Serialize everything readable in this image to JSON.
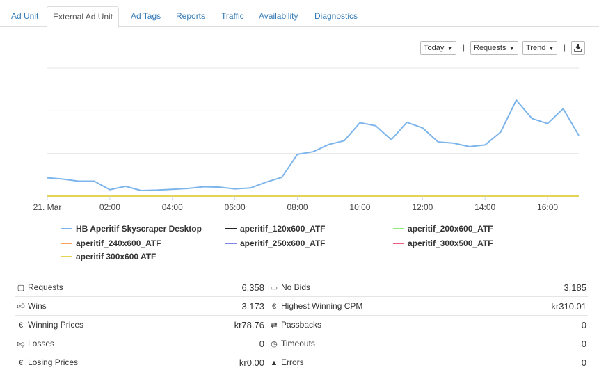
{
  "tabs": [
    {
      "label": "Ad Unit",
      "active": false
    },
    {
      "label": "External Ad Unit",
      "active": true
    },
    {
      "label": "Ad Tags",
      "active": false
    },
    {
      "label": "Reports",
      "active": false
    },
    {
      "label": "Traffic",
      "active": false
    },
    {
      "label": "Availability",
      "active": false
    },
    {
      "label": "Diagnostics",
      "active": false
    }
  ],
  "toolbar": {
    "range": "Today",
    "metric": "Requests",
    "mode": "Trend",
    "separator": "|",
    "download_icon": "download-icon"
  },
  "chart_data": {
    "type": "line",
    "x_tick_labels": [
      "21. Mar",
      "02:00",
      "04:00",
      "06:00",
      "08:00",
      "10:00",
      "12:00",
      "14:00",
      "16:00"
    ],
    "x_hours": [
      0,
      0.5,
      1,
      1.5,
      2,
      2.5,
      3,
      3.5,
      4,
      4.5,
      5,
      5.5,
      6,
      6.5,
      7,
      7.5,
      8,
      8.5,
      9,
      9.5,
      10,
      10.5,
      11,
      11.5,
      12,
      12.5,
      13,
      13.5,
      14,
      14.5,
      15,
      15.5,
      16,
      16.5,
      17
    ],
    "ylim": [
      0,
      300
    ],
    "grid": true,
    "series": [
      {
        "name": "HB Aperitif Skyscraper Desktop",
        "color": "#7cb5ec",
        "values": [
          43,
          40,
          35,
          35,
          15,
          23,
          13,
          14,
          16,
          18,
          22,
          21,
          17,
          19,
          33,
          44,
          98,
          104,
          121,
          130,
          172,
          165,
          132,
          173,
          160,
          127,
          124,
          116,
          120,
          150,
          225,
          182,
          170,
          205,
          142
        ]
      },
      {
        "name": "aperitif_120x600_ATF",
        "color": "#222222",
        "values": []
      },
      {
        "name": "aperitif_200x600_ATF",
        "color": "#90ed7d",
        "values": []
      },
      {
        "name": "aperitif_240x600_ATF",
        "color": "#f7a35c",
        "values": []
      },
      {
        "name": "aperitif_250x600_ATF",
        "color": "#8085e9",
        "values": []
      },
      {
        "name": "aperitif_300x500_ATF",
        "color": "#f15c80",
        "values": []
      },
      {
        "name": "aperitif 300x600 ATF",
        "color": "#e4d354",
        "values": []
      }
    ]
  },
  "stats": {
    "left": [
      {
        "icon": "square-icon",
        "label": "Requests",
        "value": "6,358"
      },
      {
        "icon": "thumbs-up-icon",
        "label": "Wins",
        "value": "3,173"
      },
      {
        "icon": "euro-icon",
        "label": "Winning Prices",
        "value": "kr78.76"
      },
      {
        "icon": "thumbs-down-icon",
        "label": "Losses",
        "value": "0"
      },
      {
        "icon": "euro-icon",
        "label": "Losing Prices",
        "value": "kr0.00"
      }
    ],
    "right": [
      {
        "icon": "monitor-icon",
        "label": "No Bids",
        "value": "3,185"
      },
      {
        "icon": "euro-icon",
        "label": "Highest Winning CPM",
        "value": "kr310.01"
      },
      {
        "icon": "exchange-icon",
        "label": "Passbacks",
        "value": "0"
      },
      {
        "icon": "clock-icon",
        "label": "Timeouts",
        "value": "0"
      },
      {
        "icon": "warning-icon",
        "label": "Errors",
        "value": "0"
      }
    ]
  }
}
